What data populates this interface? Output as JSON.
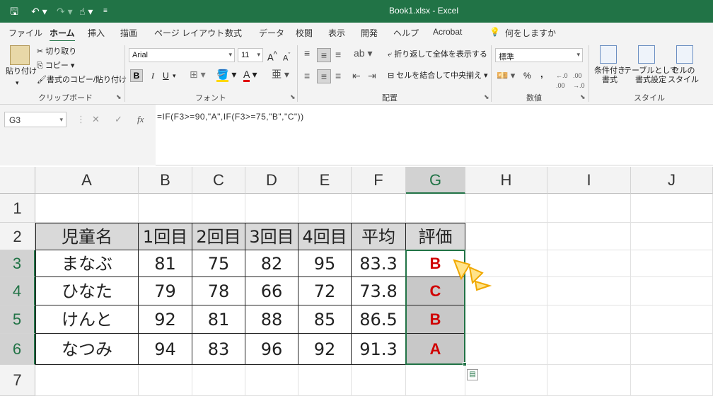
{
  "title_bar": {
    "doc_title": "Book1.xlsx  -  Excel"
  },
  "tabs": [
    "ファイル",
    "ホーム",
    "挿入",
    "描画",
    "ページ レイアウト",
    "数式",
    "データ",
    "校閲",
    "表示",
    "開発",
    "ヘルプ",
    "Acrobat",
    "何をしますか"
  ],
  "ribbon": {
    "clipboard": {
      "paste": "貼り付け",
      "cut": "切り取り",
      "copy": "コピー",
      "format_painter": "書式のコピー/貼り付け",
      "label": "クリップボード"
    },
    "font": {
      "name": "Arial",
      "size": "11",
      "bold": "B",
      "italic": "I",
      "underline": "U",
      "label": "フォント"
    },
    "alignment": {
      "wrap": "折り返して全体を表示する",
      "merge": "セルを結合して中央揃え",
      "label": "配置"
    },
    "number": {
      "format": "標準",
      "percent": "%",
      "comma": ",",
      "label": "数値"
    },
    "styles": {
      "conditional": "条件付き\n書式",
      "table": "テーブルとして\n書式設定",
      "cell": "セルの\nスタイル",
      "label": "スタイル"
    }
  },
  "formula_bar": {
    "name_box": "G3",
    "fx": "fx",
    "formula": "=IF(F3>=90,\"A\",IF(F3>=75,\"B\",\"C\"))"
  },
  "grid": {
    "columns": [
      "A",
      "B",
      "C",
      "D",
      "E",
      "F",
      "G",
      "H",
      "I",
      "J"
    ],
    "rows": [
      "1",
      "2",
      "3",
      "4",
      "5",
      "6",
      "7"
    ],
    "header_row": [
      "児童名",
      "1回目",
      "2回目",
      "3回目",
      "4回目",
      "平均",
      "評価"
    ],
    "data": [
      [
        "まなぶ",
        "81",
        "75",
        "82",
        "95",
        "83.3",
        "B"
      ],
      [
        "ひなた",
        "79",
        "78",
        "66",
        "72",
        "73.8",
        "C"
      ],
      [
        "けんと",
        "92",
        "81",
        "88",
        "85",
        "86.5",
        "B"
      ],
      [
        "なつみ",
        "94",
        "83",
        "96",
        "92",
        "91.3",
        "A"
      ]
    ]
  },
  "colors": {
    "excel_green": "#217346",
    "grade_red": "#d00000"
  }
}
